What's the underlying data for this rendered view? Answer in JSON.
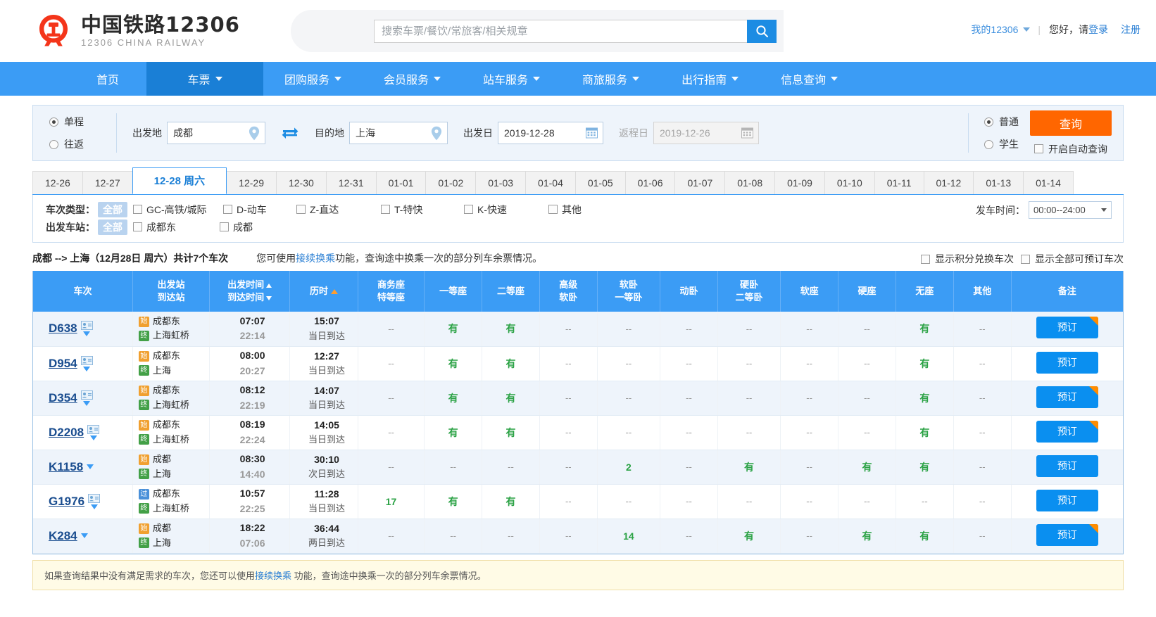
{
  "brand": {
    "cn": "中国铁路12306",
    "en": "12306 CHINA RAILWAY"
  },
  "search": {
    "placeholder": "搜索车票/餐饮/常旅客/相关规章",
    "value": ""
  },
  "account": {
    "my": "我的12306",
    "hello": "您好，请",
    "login": "登录",
    "register": "注册"
  },
  "nav": [
    {
      "label": "首页",
      "caret": false,
      "active": false
    },
    {
      "label": "车票",
      "caret": true,
      "active": true
    },
    {
      "label": "团购服务",
      "caret": true,
      "active": false
    },
    {
      "label": "会员服务",
      "caret": true,
      "active": false
    },
    {
      "label": "站车服务",
      "caret": true,
      "active": false
    },
    {
      "label": "商旅服务",
      "caret": true,
      "active": false
    },
    {
      "label": "出行指南",
      "caret": true,
      "active": false
    },
    {
      "label": "信息查询",
      "caret": true,
      "active": false
    }
  ],
  "form": {
    "trip_oneway": "单程",
    "trip_round": "往返",
    "from_label": "出发地",
    "from_value": "成都",
    "to_label": "目的地",
    "to_value": "上海",
    "depart_label": "出发日",
    "depart_value": "2019-12-28",
    "return_label": "返程日",
    "return_value": "2019-12-26",
    "pass_normal": "普通",
    "pass_student": "学生",
    "query_btn": "查询",
    "auto_query": "开启自动查询"
  },
  "date_tabs": [
    {
      "label": "12-26",
      "active": false
    },
    {
      "label": "12-27",
      "active": false
    },
    {
      "label": "12-28 周六",
      "active": true
    },
    {
      "label": "12-29",
      "active": false
    },
    {
      "label": "12-30",
      "active": false
    },
    {
      "label": "12-31",
      "active": false
    },
    {
      "label": "01-01",
      "active": false
    },
    {
      "label": "01-02",
      "active": false
    },
    {
      "label": "01-03",
      "active": false
    },
    {
      "label": "01-04",
      "active": false
    },
    {
      "label": "01-05",
      "active": false
    },
    {
      "label": "01-06",
      "active": false
    },
    {
      "label": "01-07",
      "active": false
    },
    {
      "label": "01-08",
      "active": false
    },
    {
      "label": "01-09",
      "active": false
    },
    {
      "label": "01-10",
      "active": false
    },
    {
      "label": "01-11",
      "active": false
    },
    {
      "label": "01-12",
      "active": false
    },
    {
      "label": "01-13",
      "active": false
    },
    {
      "label": "01-14",
      "active": false
    }
  ],
  "filters": {
    "train_type_label": "车次类型：",
    "all_badge": "全部",
    "train_types": [
      "GC-高铁/城际",
      "D-动车",
      "Z-直达",
      "T-特快",
      "K-快速",
      "其他"
    ],
    "station_label": "出发车站：",
    "stations": [
      "成都东",
      "成都"
    ],
    "time_label": "发车时间：",
    "time_value": "00:00--24:00"
  },
  "summary": {
    "route": "成都 --> 上海（12月28日 周六）共计7个车次",
    "hint_pre": "您可使用",
    "hint_link": "接续换乘",
    "hint_post": "功能，查询途中换乘一次的部分列车余票情况。",
    "chk_points": "显示积分兑换车次",
    "chk_all": "显示全部可预订车次"
  },
  "table": {
    "headers": {
      "train": "车次",
      "station_from": "出发站",
      "station_to": "到达站",
      "time_dep": "出发时间",
      "time_arr": "到达时间",
      "duration": "历时",
      "business_1": "商务座",
      "business_2": "特等座",
      "first": "一等座",
      "second": "二等座",
      "deluxe_1": "高级",
      "deluxe_2": "软卧",
      "soft_1": "软卧",
      "soft_2": "一等卧",
      "motor": "动卧",
      "hard_1": "硬卧",
      "hard_2": "二等卧",
      "soft_seat": "软座",
      "hard_seat": "硬座",
      "no_seat": "无座",
      "other": "其他",
      "remark": "备注"
    },
    "book_label": "预订",
    "rows": [
      {
        "train": "D638",
        "has_card": true,
        "from_badge": "始",
        "from_type": "start",
        "from": "成都东",
        "to_badge": "终",
        "to_type": "end",
        "to": "上海虹桥",
        "dep": "07:07",
        "arr": "22:14",
        "dur": "15:07",
        "day": "当日到达",
        "business": "--",
        "first": "有",
        "second": "有",
        "deluxe": "--",
        "soft": "--",
        "motor": "--",
        "hard": "--",
        "soft_seat": "--",
        "hard_seat": "--",
        "no_seat": "有",
        "other": "--",
        "ribbon": true
      },
      {
        "train": "D954",
        "has_card": true,
        "from_badge": "始",
        "from_type": "start",
        "from": "成都东",
        "to_badge": "终",
        "to_type": "end",
        "to": "上海",
        "dep": "08:00",
        "arr": "20:27",
        "dur": "12:27",
        "day": "当日到达",
        "business": "--",
        "first": "有",
        "second": "有",
        "deluxe": "--",
        "soft": "--",
        "motor": "--",
        "hard": "--",
        "soft_seat": "--",
        "hard_seat": "--",
        "no_seat": "有",
        "other": "--",
        "ribbon": false
      },
      {
        "train": "D354",
        "has_card": true,
        "from_badge": "始",
        "from_type": "start",
        "from": "成都东",
        "to_badge": "终",
        "to_type": "end",
        "to": "上海虹桥",
        "dep": "08:12",
        "arr": "22:19",
        "dur": "14:07",
        "day": "当日到达",
        "business": "--",
        "first": "有",
        "second": "有",
        "deluxe": "--",
        "soft": "--",
        "motor": "--",
        "hard": "--",
        "soft_seat": "--",
        "hard_seat": "--",
        "no_seat": "有",
        "other": "--",
        "ribbon": true
      },
      {
        "train": "D2208",
        "has_card": true,
        "from_badge": "始",
        "from_type": "start",
        "from": "成都东",
        "to_badge": "终",
        "to_type": "end",
        "to": "上海虹桥",
        "dep": "08:19",
        "arr": "22:24",
        "dur": "14:05",
        "day": "当日到达",
        "business": "--",
        "first": "有",
        "second": "有",
        "deluxe": "--",
        "soft": "--",
        "motor": "--",
        "hard": "--",
        "soft_seat": "--",
        "hard_seat": "--",
        "no_seat": "有",
        "other": "--",
        "ribbon": true
      },
      {
        "train": "K1158",
        "has_card": false,
        "from_badge": "始",
        "from_type": "start",
        "from": "成都",
        "to_badge": "终",
        "to_type": "end",
        "to": "上海",
        "dep": "08:30",
        "arr": "14:40",
        "dur": "30:10",
        "day": "次日到达",
        "business": "--",
        "first": "--",
        "second": "--",
        "deluxe": "--",
        "soft": "2",
        "motor": "--",
        "hard": "有",
        "soft_seat": "--",
        "hard_seat": "有",
        "no_seat": "有",
        "other": "--",
        "ribbon": false
      },
      {
        "train": "G1976",
        "has_card": true,
        "from_badge": "过",
        "from_type": "pass",
        "from": "成都东",
        "to_badge": "终",
        "to_type": "end",
        "to": "上海虹桥",
        "dep": "10:57",
        "arr": "22:25",
        "dur": "11:28",
        "day": "当日到达",
        "business": "17",
        "first": "有",
        "second": "有",
        "deluxe": "--",
        "soft": "--",
        "motor": "--",
        "hard": "--",
        "soft_seat": "--",
        "hard_seat": "--",
        "no_seat": "--",
        "other": "--",
        "ribbon": false
      },
      {
        "train": "K284",
        "has_card": false,
        "from_badge": "始",
        "from_type": "start",
        "from": "成都",
        "to_badge": "终",
        "to_type": "end",
        "to": "上海",
        "dep": "18:22",
        "arr": "07:06",
        "dur": "36:44",
        "day": "两日到达",
        "business": "--",
        "first": "--",
        "second": "--",
        "deluxe": "--",
        "soft": "14",
        "motor": "--",
        "hard": "有",
        "soft_seat": "--",
        "hard_seat": "有",
        "no_seat": "有",
        "other": "--",
        "ribbon": true
      }
    ]
  },
  "footer_note": {
    "pre": "如果查询结果中没有满足需求的车次，您还可以使用",
    "link": "接续换乘",
    "post": " 功能，查询途中换乘一次的部分列车余票情况。"
  }
}
